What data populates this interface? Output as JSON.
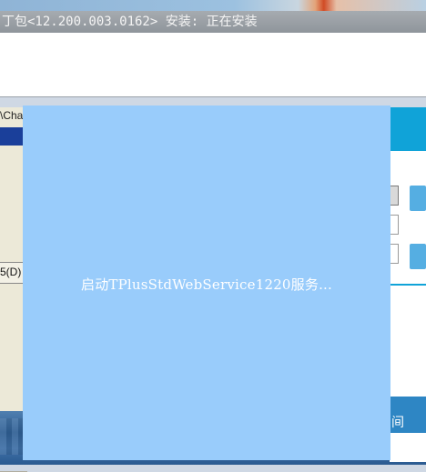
{
  "installer": {
    "title": "丁包<12.200.003.0162> 安装: 正在安装"
  },
  "mid_window": {
    "path_fragment": "\\Cha",
    "tab_label": "5(D)"
  },
  "right_window": {
    "bottom_button_label": "间"
  },
  "status_panel": {
    "message": "启动TPlusStdWebService1220服务..."
  },
  "colors": {
    "status_panel_bg": "#99ccfb",
    "accent_blue": "#10a3d8",
    "button_blue": "#55aee2"
  }
}
